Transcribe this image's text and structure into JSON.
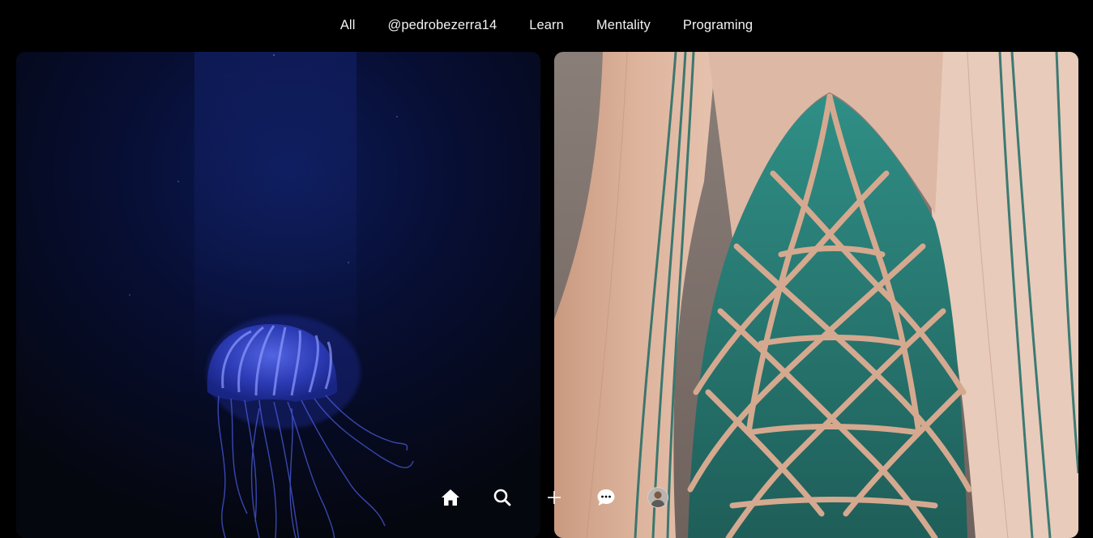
{
  "top_nav": {
    "items": [
      {
        "label": "All"
      },
      {
        "label": "@pedrobezerra14"
      },
      {
        "label": "Learn"
      },
      {
        "label": "Mentality"
      },
      {
        "label": "Programing"
      }
    ]
  },
  "feed": {
    "posts": [
      {
        "subject": "jellyfish-photo",
        "accent": "#2e3fb6"
      },
      {
        "subject": "tiled-arch-photo",
        "accent": "#1f7a72"
      }
    ]
  },
  "bottom_bar": {
    "icons": [
      "home-icon",
      "search-icon",
      "plus-icon",
      "chat-icon",
      "avatar"
    ]
  }
}
